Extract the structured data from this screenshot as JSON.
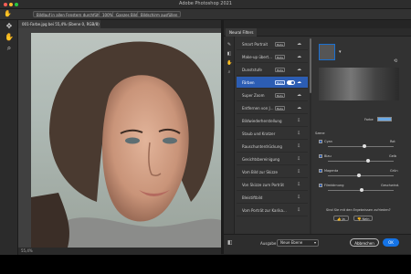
{
  "window": {
    "title": "Adobe Photoshop 2021"
  },
  "options_bar": {
    "buttons": [
      "Bildlauf in allen Fenstern durchführen",
      "100%",
      "Ganzes Bild",
      "Bildschirm ausfüllen"
    ]
  },
  "document": {
    "tab_label": "001-Farbe.jpg bei 55,4% (Ebene 0, RGB/8) *",
    "status": "55,4%"
  },
  "neural_filters": {
    "tab_label": "Neural Filters",
    "filters": [
      {
        "label": "Smart Portrait",
        "beta": "Beta"
      },
      {
        "label": "Make-up übert...",
        "beta": "Beta"
      },
      {
        "label": "Dunststufe",
        "beta": "Beta"
      },
      {
        "label": "Färben",
        "beta": "Beta"
      },
      {
        "label": "Super Zoom",
        "beta": "Beta"
      },
      {
        "label": "Entfernen von J...",
        "beta": "Beta"
      },
      {
        "label": "Bildwiederherstellung",
        "beta": ""
      },
      {
        "label": "Staub und Kratzer",
        "beta": ""
      },
      {
        "label": "Rauschunterdrückung",
        "beta": ""
      },
      {
        "label": "Gesichtsbereinigung",
        "beta": ""
      },
      {
        "label": "Vom Bild zur Skizze",
        "beta": ""
      },
      {
        "label": "Von Skizze zum Porträt",
        "beta": ""
      },
      {
        "label": "Bleistiftbild",
        "beta": ""
      },
      {
        "label": "Vom Porträt zur Karika...",
        "beta": ""
      }
    ],
    "selected_index": 3,
    "settings": {
      "color_label": "Farbe",
      "section_label": "Szene",
      "sliders": [
        {
          "left": "Cyan",
          "right": "Rot",
          "value": 0.55
        },
        {
          "left": "Blau",
          "right": "Gelb",
          "value": 0.6
        },
        {
          "left": "Magenta",
          "right": "Grün",
          "value": 0.45
        },
        {
          "left": "Filmkörnung",
          "right": "Geschwind.",
          "value": 0.5
        }
      ],
      "question": "Sind Sie mit den Ergebnissen zufrieden?",
      "yes": "Ja",
      "no": "Nein"
    },
    "footer": {
      "output_label": "Ausgabe",
      "output_value": "Neue Ebene",
      "cancel": "Abbrechen",
      "ok": "OK"
    }
  },
  "colors": {
    "accent": "#2c5db3",
    "ok_button": "#1473e6"
  }
}
